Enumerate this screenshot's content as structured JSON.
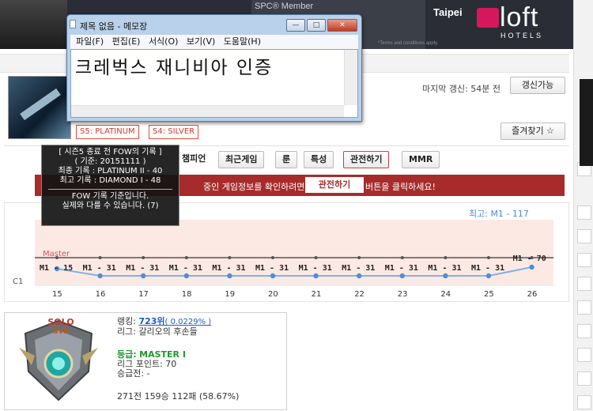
{
  "banner": {
    "member_text": "SPC® Member",
    "terms_text": "*Terms and conditions apply.",
    "city": "Taipei",
    "brand": "loft",
    "brand_sub": "HOTELS",
    "left_char": "S"
  },
  "notepad": {
    "title": "제목 없음 - 메모장",
    "menu": [
      "파일(F)",
      "편집(E)",
      "서식(O)",
      "보기(V)",
      "도움말(H)"
    ],
    "content": "크레벅스 재니비아 인증",
    "minimize": "—",
    "maximize": "□",
    "close": "✕"
  },
  "profile": {
    "last_update": "마지막 갱신: 54분 전",
    "update_button": "갱신가능",
    "favorite_button": "즐겨찾기 ☆",
    "badges": [
      "S5: PLATINUM",
      "S4: SILVER"
    ]
  },
  "tooltip": {
    "line1": "[ 시즌5 종료 전 FOW의 기록 ]",
    "line2": "( 기준: 20151111 )",
    "line3": "최종 기록 : PLATINUM II - 40",
    "line4": "최고 기록 : DIAMOND I - 48",
    "line5": "FOW 기록 기준입니다.",
    "line6": "실제와 다를 수 있습니다. (7)"
  },
  "tabs": [
    "챔피언",
    "최근게임",
    "룬",
    "특성",
    "관전하기",
    "MMR"
  ],
  "spectate_bar": {
    "text1": "중인 게임정보를 확인하려면",
    "button": "관전하기",
    "text2": "버튼을 클릭하세요!"
  },
  "chart_data": {
    "type": "line",
    "max_label": "최고: M1 - 117",
    "x": [
      "15",
      "16",
      "17",
      "18",
      "19",
      "20",
      "21",
      "22",
      "23",
      "24",
      "25",
      "26"
    ],
    "series": [
      {
        "name": "Master",
        "values": [
          "M1 - 15",
          "M1 - 31",
          "M1 - 31",
          "M1 - 31",
          "M1 - 31",
          "M1 - 31",
          "M1 - 31",
          "M1 - 31",
          "M1 - 31",
          "M1 - 31",
          "M1 - 31",
          "M1 - 70"
        ]
      }
    ],
    "band_label": "Master",
    "left_label": "C1",
    "colors": {
      "line": "#7fb2e5",
      "point": "#4a90d9",
      "threshold": "#555555",
      "band": "#fde9e4"
    }
  },
  "rank": {
    "queue": "SOLO",
    "mode": "5v5",
    "ranking_label": "랭킹:",
    "ranking_value": "723위",
    "ranking_pct": "( 0.0229% )",
    "league": "리그: 갈리오의 후손들",
    "tier_label": "등급:",
    "tier": "MASTER I",
    "lp": "리그 포인트: 70",
    "promo": "승급전: -",
    "record": "271전 159승 112패 (58.67%)"
  }
}
